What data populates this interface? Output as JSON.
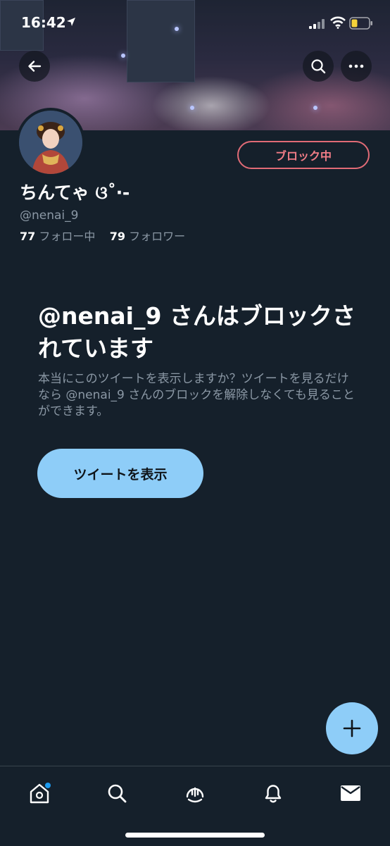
{
  "status_bar": {
    "time": "16:42"
  },
  "profile": {
    "display_name": "ちんてゃ ଓ˚‧-",
    "handle": "@nenai_9",
    "following_count": "77",
    "following_label": "フォロー中",
    "followers_count": "79",
    "followers_label": "フォロワー",
    "block_button_label": "ブロック中"
  },
  "blocked_notice": {
    "title": "@nenai_9 さんはブロックされています",
    "description": "本当にこのツイートを表示しますか？ツイートを見るだけなら @nenai_9 さんのブロックを解除しなくても見ることができます。",
    "view_button_label": "ツイートを表示"
  },
  "tab_bar": {
    "items": [
      "home-icon",
      "search-icon",
      "spaces-icon",
      "notifications-icon",
      "messages-icon"
    ],
    "home_has_badge": true
  },
  "colors": {
    "background": "#15202b",
    "accent": "#8ecdf8",
    "block_red": "#e16b76",
    "secondary_text": "#8b98a5"
  }
}
